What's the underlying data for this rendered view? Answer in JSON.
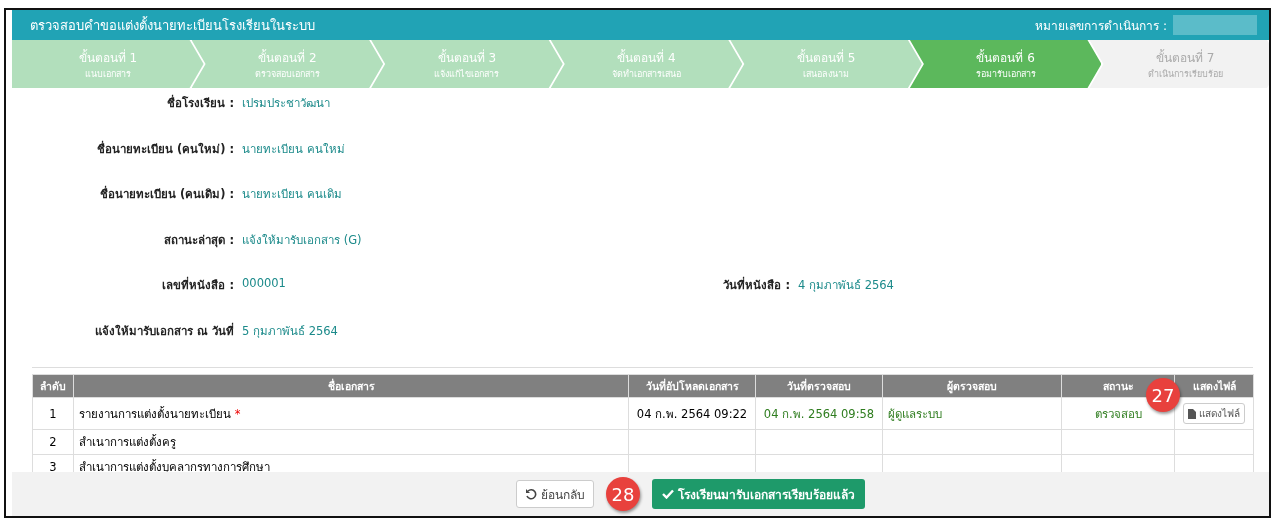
{
  "header": {
    "title": "ตรวจสอบคำขอแต่งตั้งนายทะเบียนโรงเรียนในระบบ",
    "reference_label": "หมายเลขการดำเนินการ :"
  },
  "steps": [
    {
      "title": "ขั้นตอนที่ 1",
      "subtitle": "แนบเอกสาร",
      "selected": false,
      "completed": true
    },
    {
      "title": "ขั้นตอนที่ 2",
      "subtitle": "ตรวจสอบเอกสาร",
      "selected": false,
      "completed": true
    },
    {
      "title": "ขั้นตอนที่ 3",
      "subtitle": "แจ้งแก้ไขเอกสาร",
      "selected": false,
      "completed": true
    },
    {
      "title": "ขั้นตอนที่ 4",
      "subtitle": "จัดทำเอกสารเสนอ",
      "selected": false,
      "completed": true
    },
    {
      "title": "ขั้นตอนที่ 5",
      "subtitle": "เสนอลงนาม",
      "selected": false,
      "completed": true
    },
    {
      "title": "ขั้นตอนที่ 6",
      "subtitle": "รอมารับเอกสาร",
      "selected": true,
      "completed": false
    },
    {
      "title": "ขั้นตอนที่ 7",
      "subtitle": "ดำเนินการเรียบร้อย",
      "selected": false,
      "completed": false
    }
  ],
  "details": [
    [
      {
        "label": "ชื่อโรงเรียน :",
        "value": "เปรมประชาวัฒนา"
      }
    ],
    [
      {
        "label": "ชื่อนายทะเบียน (คนใหม่) :",
        "value": "นายทะเบียน คนใหม่"
      }
    ],
    [
      {
        "label": "ชื่อนายทะเบียน (คนเดิม) :",
        "value": "นายทะเบียน คนเดิม"
      }
    ],
    [
      {
        "label": "สถานะล่าสุด :",
        "value": "แจ้งให้มารับเอกสาร (G)"
      }
    ],
    [
      {
        "label": "เลขที่หนังสือ :",
        "value": "000001"
      },
      {
        "label": "วันที่หนังสือ :",
        "value": "4 กุมภาพันธ์ 2564"
      }
    ],
    [
      {
        "label": "แจ้งให้มารับเอกสาร ณ วันที่",
        "value": "5 กุมภาพันธ์ 2564"
      }
    ]
  ],
  "table": {
    "columns": [
      "ลำดับ",
      "ชื่อเอกสาร",
      "วันที่อัปโหลดเอกสาร",
      "วันที่ตรวจสอบ",
      "ผู้ตรวจสอบ",
      "สถานะ",
      "แสดงไฟล์"
    ],
    "rows": [
      {
        "no": "1",
        "name": "รายงานการแต่งตั้งนายทะเบียน",
        "required_mark": "*",
        "uploaded": "04 ก.พ. 2564 09:22",
        "checked": "04 ก.พ. 2564 09:58",
        "checker": "ผู้ดูแลระบบ",
        "status": "ตรวจสอบ",
        "file_button": "แสดงไฟล์"
      },
      {
        "no": "2",
        "name": "สำเนาการแต่งตั้งครู"
      },
      {
        "no": "3",
        "name": "สำเนาการแต่งตั้งบุคลากรทางการศึกษา"
      }
    ]
  },
  "buttons": {
    "back": "ย้อนกลับ",
    "confirm": "โรงเรียนมารับเอกสารเรียบร้อยแล้ว"
  },
  "callouts": [
    {
      "number": "27"
    },
    {
      "number": "28"
    }
  ]
}
